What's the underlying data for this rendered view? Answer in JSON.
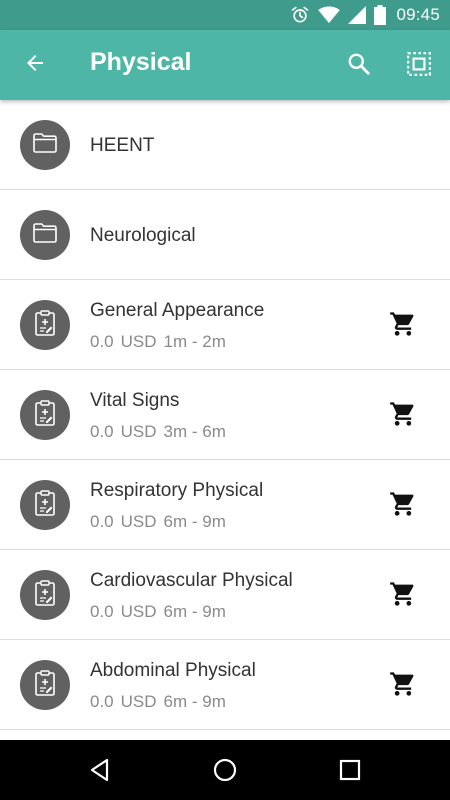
{
  "status_bar": {
    "time": "09:45",
    "icons": [
      "alarm-icon",
      "wifi-icon",
      "signal-icon",
      "battery-icon"
    ]
  },
  "app_bar": {
    "title": "Physical",
    "icons": [
      "back-arrow-icon",
      "search-icon",
      "select-all-icon"
    ]
  },
  "list": {
    "folders": [
      {
        "title": "HEENT",
        "icon": "folder-icon"
      },
      {
        "title": "Neurological",
        "icon": "folder-icon"
      }
    ],
    "items": [
      {
        "title": "General Appearance",
        "price": "0.0",
        "currency": "USD",
        "duration": "1m - 2m",
        "icon": "clipboard-icon",
        "action_icon": "cart-icon"
      },
      {
        "title": "Vital Signs",
        "price": "0.0",
        "currency": "USD",
        "duration": "3m - 6m",
        "icon": "clipboard-icon",
        "action_icon": "cart-icon"
      },
      {
        "title": "Respiratory Physical",
        "price": "0.0",
        "currency": "USD",
        "duration": "6m - 9m",
        "icon": "clipboard-icon",
        "action_icon": "cart-icon"
      },
      {
        "title": "Cardiovascular Physical",
        "price": "0.0",
        "currency": "USD",
        "duration": "6m - 9m",
        "icon": "clipboard-icon",
        "action_icon": "cart-icon"
      },
      {
        "title": "Abdominal Physical",
        "price": "0.0",
        "currency": "USD",
        "duration": "6m - 9m",
        "icon": "clipboard-icon",
        "action_icon": "cart-icon"
      }
    ]
  },
  "nav_bar": {
    "icons": [
      "nav-back-icon",
      "nav-home-icon",
      "nav-recents-icon"
    ]
  },
  "colors": {
    "status_bar": "#3f9b8b",
    "app_bar": "#4db6a6",
    "avatar": "#616161",
    "nav_bar": "#000000"
  }
}
